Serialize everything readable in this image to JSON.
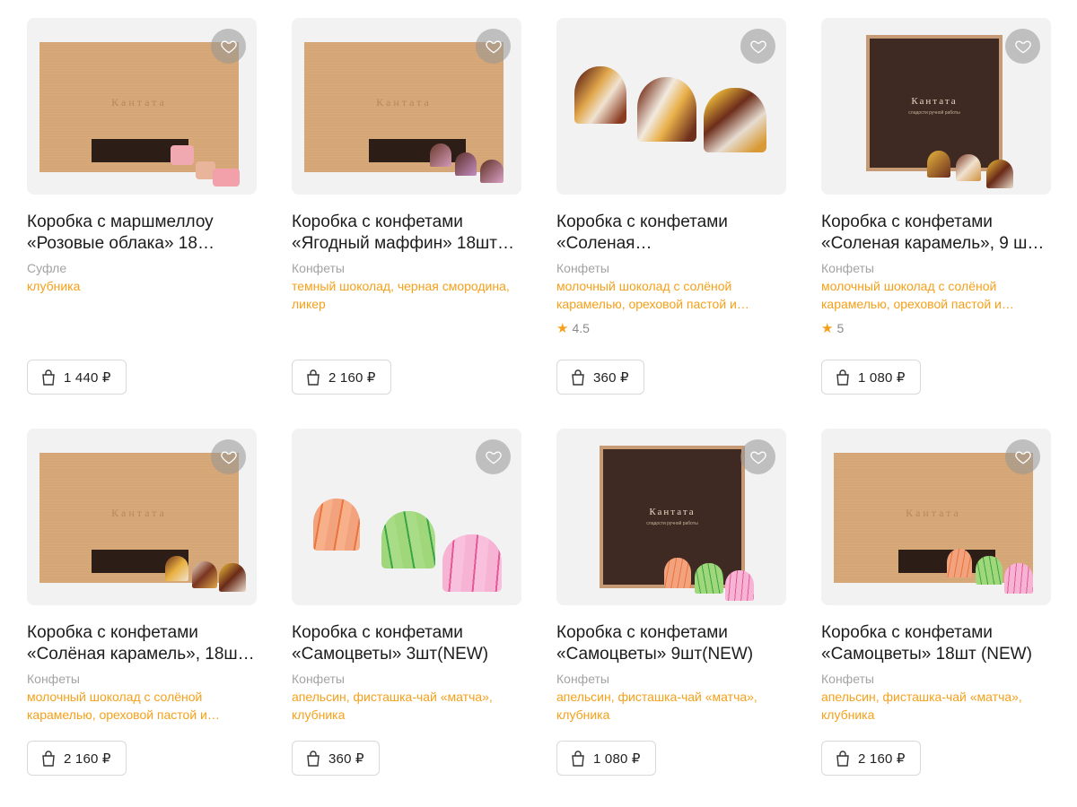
{
  "currency": "₽",
  "colors": {
    "accent": "#f5a01a",
    "muted": "#a3a3a3",
    "card_bg": "#f2f2f3"
  },
  "products": [
    {
      "title": "Коробка с маршмеллоу «Розовые облака» 18…",
      "category": "Суфле",
      "flavors": "клубника",
      "rating": "",
      "price": "1 440 ₽",
      "image": "kraft-box-marshmallow",
      "brand": "Кантата"
    },
    {
      "title": "Коробка с конфетами «Ягодный маффин» 18шт…",
      "category": "Конфеты",
      "flavors": "темный шоколад, черная смородина, ликер",
      "rating": "",
      "price": "2 160 ₽",
      "image": "kraft-box-berry",
      "brand": "Кантата"
    },
    {
      "title": "Коробка с конфетами «Соленая…",
      "category": "Конфеты",
      "flavors": "молочный шоколад с солёной карамелью, ореховой пастой и…",
      "rating": "4.5",
      "price": "360 ₽",
      "image": "three-caramel-candies"
    },
    {
      "title": "Коробка с конфетами «Соленая карамель», 9 ш…",
      "category": "Конфеты",
      "flavors": "молочный шоколад с солёной карамелью, ореховой пастой и…",
      "rating": "5",
      "price": "1 080 ₽",
      "image": "dark-box-caramel",
      "brand": "Кантата",
      "brand_sub": "сладости ручной работы"
    },
    {
      "title": "Коробка с конфетами «Солёная карамель», 18ш…",
      "category": "Конфеты",
      "flavors": "молочный шоколад с солёной карамелью, ореховой пастой и…",
      "rating": "",
      "price": "2 160 ₽",
      "image": "kraft-box-caramel",
      "brand": "Кантата"
    },
    {
      "title": "Коробка с конфетами «Самоцветы» 3шт(NEW)",
      "category": "Конфеты",
      "flavors": "апельсин, фисташка-чай «матча», клубника",
      "rating": "",
      "price": "360 ₽",
      "image": "three-colored-candies"
    },
    {
      "title": "Коробка с конфетами «Самоцветы» 9шт(NEW)",
      "category": "Конфеты",
      "flavors": "апельсин, фисташка-чай «матча», клубника",
      "rating": "",
      "price": "1 080 ₽",
      "image": "dark-box-gems",
      "brand": "Кантата",
      "brand_sub": "сладости ручной работы"
    },
    {
      "title": "Коробка с конфетами «Самоцветы» 18шт (NEW)",
      "category": "Конфеты",
      "flavors": "апельсин, фисташка-чай «матча», клубника",
      "rating": "",
      "price": "2 160 ₽",
      "image": "kraft-box-gems",
      "brand": "Кантата"
    }
  ],
  "icons": {
    "favorite": "heart-icon",
    "cart": "shopping-bag-icon",
    "rating": "star-icon"
  }
}
